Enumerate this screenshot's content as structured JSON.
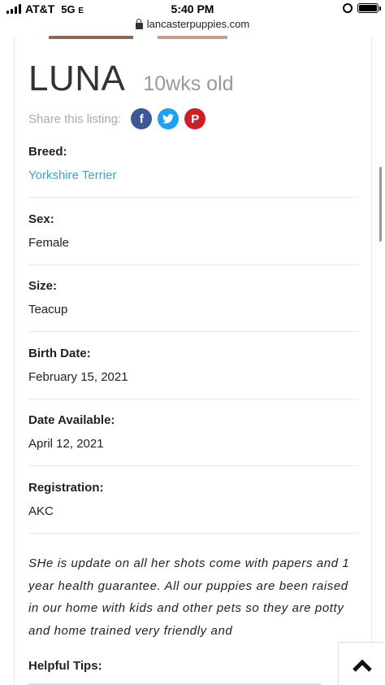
{
  "status_bar": {
    "carrier": "AT&T",
    "network": "5G",
    "network_suffix": "E",
    "time": "5:40 PM",
    "battery_level": 1.0
  },
  "browser": {
    "url": "lancasterpuppies.com"
  },
  "listing": {
    "name": "LUNA",
    "age": "10wks old",
    "share_label": "Share this listing:",
    "social": {
      "facebook": "f",
      "pinterest": "P"
    },
    "fields": [
      {
        "label": "Breed:",
        "value": "Yorkshire Terrier"
      },
      {
        "label": "Sex:",
        "value": "Female"
      },
      {
        "label": "Size:",
        "value": "Teacup"
      },
      {
        "label": "Birth Date:",
        "value": "February 15, 2021"
      },
      {
        "label": "Date Available:",
        "value": "April 12, 2021"
      },
      {
        "label": "Registration:",
        "value": "AKC"
      }
    ],
    "description": "SHe is update on all her shots come with papers and 1 year health guarantee. All our puppies are been raised in our home with kids and other pets so they are potty and home trained very friendly and",
    "helpful_tips_label": "Helpful Tips:"
  },
  "colors": {
    "link": "#3aa7c9",
    "facebook": "#3b5998",
    "twitter": "#1da1f2",
    "pinterest": "#cb2027"
  },
  "icons": {
    "lock": "lock-icon",
    "back_to_top": "chevron-up-icon",
    "alarm": "alarm-icon",
    "battery": "battery-icon",
    "signal": "signal-icon"
  }
}
